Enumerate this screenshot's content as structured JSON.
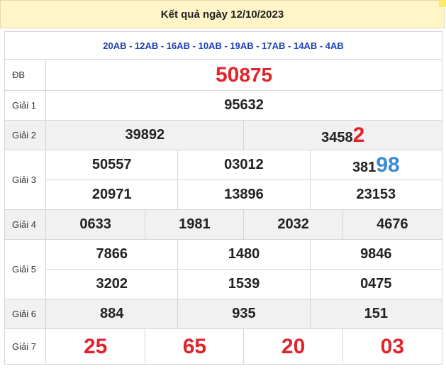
{
  "header": {
    "title": "Kết quả ngày 12/10/2023"
  },
  "codes": "20AB - 12AB - 16AB - 10AB - 19AB - 17AB - 14AB - 4AB",
  "prizes": {
    "db": {
      "label": "ĐB",
      "value_main": "5",
      "value_highlight": "0",
      "value_rest": "875"
    },
    "g1": {
      "label": "Giải 1",
      "value": "95632"
    },
    "g2": {
      "label": "Giải 2",
      "values": [
        "39892",
        "3458",
        "2"
      ]
    },
    "g3": {
      "label": "Giải 3",
      "row1": [
        "50557",
        "03012",
        "381",
        "98"
      ],
      "row2": [
        "20971",
        "13896",
        "23153"
      ]
    },
    "g4": {
      "label": "Giải 4",
      "values": [
        "0633",
        "1981",
        "2032",
        "4676"
      ]
    },
    "g5": {
      "label": "Giải 5",
      "row1": [
        "7866",
        "1480",
        "9846"
      ],
      "row2": [
        "3202",
        "1539",
        "0475"
      ]
    },
    "g6": {
      "label": "Giải 6",
      "values": [
        "884",
        "935",
        "151"
      ]
    },
    "g7": {
      "label": "Giải 7",
      "values": [
        "25",
        "65",
        "20",
        "03"
      ]
    }
  },
  "colors": {
    "accent_red": "#e3232c",
    "accent_blue": "#3a8ad8",
    "codes_blue": "#1d3fb6",
    "header_bg": "#fff5c7"
  }
}
